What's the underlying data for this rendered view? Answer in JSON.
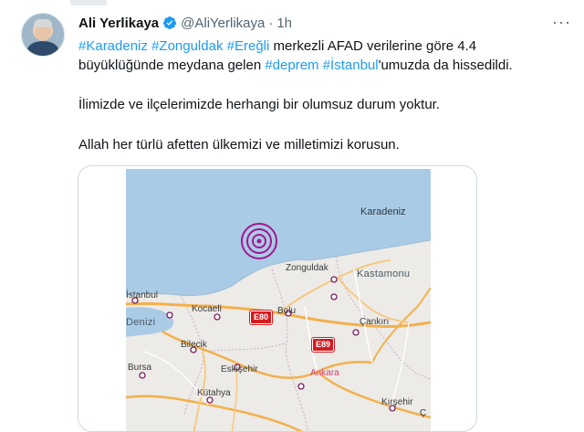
{
  "author": {
    "name": "Ali Yerlikaya",
    "handle": "@AliYerlikaya",
    "separator": "·",
    "time": "1h",
    "more": "···"
  },
  "tweet": {
    "line1": {
      "tag1": "#Karadeniz",
      "tag2": "#Zonguldak",
      "tag3": "#Ereğli",
      "text": " merkezli AFAD verilerine göre 4.4"
    },
    "line2": {
      "text1": "büyüklüğünde meydana gelen ",
      "tag1": "#deprem",
      "tag2": "#İstanbul",
      "text2": "'umuzda da hissedildi."
    },
    "line3": "İlimizde ve ilçelerimizde herhangi bir olumsuz durum yoktur.",
    "line4": "Allah her türlü afetten ülkemizi ve milletimizi korusun."
  },
  "map": {
    "sea_label": "Karadeniz",
    "cities": {
      "zonguldak": "Zonguldak",
      "kastamonu": "Kastamonu",
      "istanbul": "İstanbul",
      "kocaeli": "Kocaeli",
      "bolu": "Bolu",
      "denizi": "Denizi",
      "cankiri": "Çankırı",
      "bilecik": "Bilecik",
      "bursa": "Bursa",
      "eskisehir": "Eskişehir",
      "ankara": "Ankara",
      "kutahya": "Kütahya",
      "kirsehir": "Kırşehir",
      "c_partial": "Ç"
    },
    "roads": {
      "e80": "E80",
      "e89": "E89"
    },
    "epicenter_color": "#a0188f",
    "sea_color": "#aacbe6",
    "land_color": "#ecebe7"
  },
  "colors": {
    "link": "#1d9bf0",
    "verified": "#1d9bf0"
  }
}
